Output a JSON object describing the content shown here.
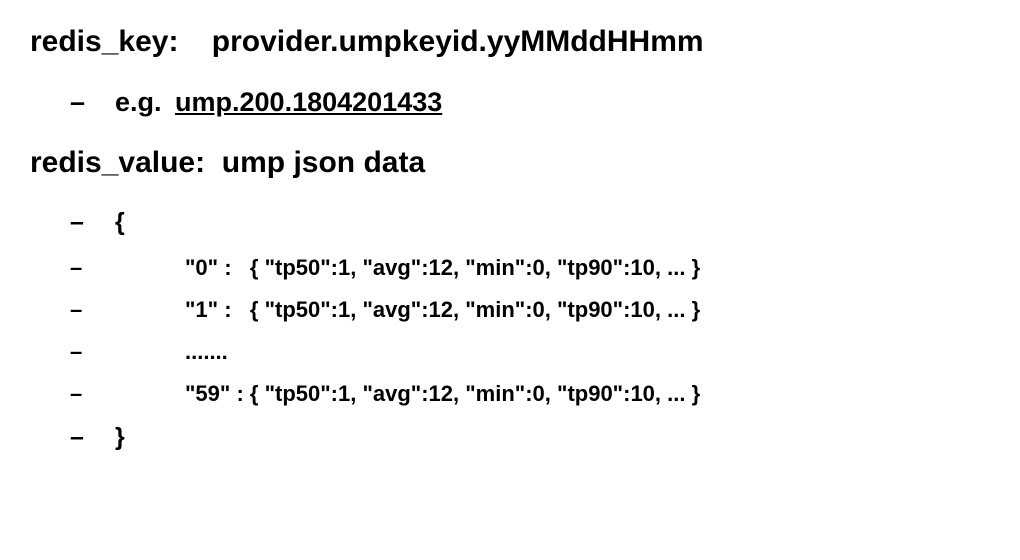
{
  "redis_key": {
    "label": "redis_key",
    "colon": ":",
    "format": "provider.umpkeyid.yyMMddHHmm",
    "example_prefix": "e.g.",
    "example_value": "ump.200.1804201433"
  },
  "redis_value": {
    "label": "redis_value",
    "colon": ":",
    "description": "ump json data"
  },
  "json_lines": {
    "open_brace": "{",
    "entry_0_key": "\"0\"",
    "entry_0_value": "{ \"tp50\":1, \"avg\":12, \"min\":0, \"tp90\":10, ... }",
    "entry_1_key": "\"1\"",
    "entry_1_value": "{ \"tp50\":1, \"avg\":12, \"min\":0, \"tp90\":10, ... }",
    "ellipsis": ".......",
    "entry_59_key": "\"59\"",
    "entry_59_value": "{ \"tp50\":1, \"avg\":12, \"min\":0, \"tp90\":10, ... }",
    "close_brace": "}"
  },
  "dash": "–"
}
